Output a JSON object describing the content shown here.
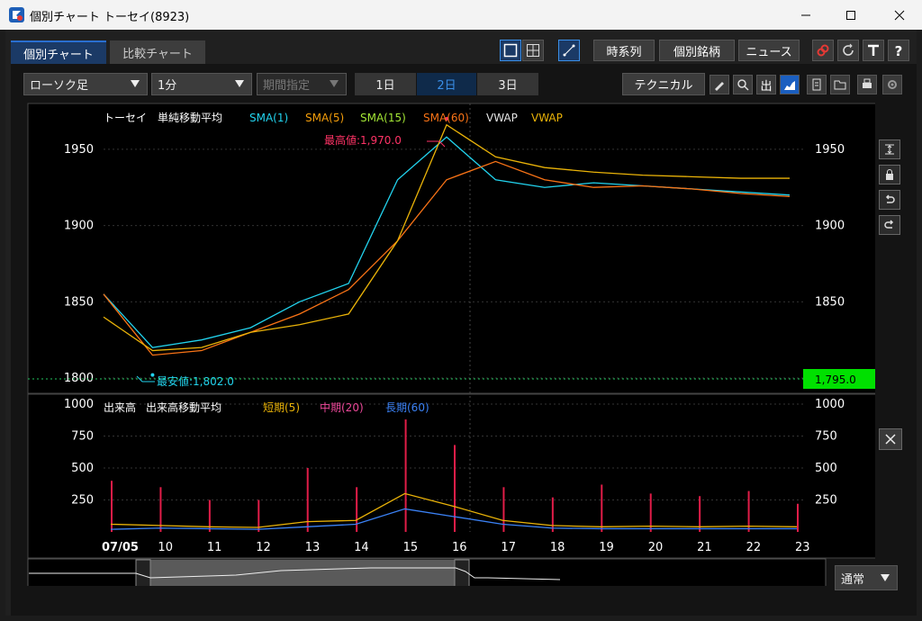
{
  "window": {
    "title": "個別チャート トーセイ(8923)"
  },
  "tabs": [
    {
      "label": "個別チャート"
    },
    {
      "label": "比較チャート"
    }
  ],
  "top_buttons": {
    "timeseries": "時系列",
    "stock": "個別銘柄",
    "news": "ニュース"
  },
  "toolbar": {
    "chart_type": "ローソク足",
    "interval": "1分",
    "period": "期間指定",
    "days": [
      "1日",
      "2日",
      "3日"
    ],
    "active_day_index": 1,
    "technical": "テクニカル",
    "out_label": "出"
  },
  "colors": {
    "sma1": "#22d3ee",
    "sma5": "#f59e0b",
    "sma15": "#a3e635",
    "sma60": "#f97316",
    "vwap1": "#e5e5e5",
    "vwap2": "#eab308",
    "vol_short": "#eab308",
    "vol_mid": "#ec4899",
    "vol_long": "#3b82f6",
    "price_tag": "#00e000",
    "high_label": "#ff3366",
    "low_label": "#22d3ee"
  },
  "price_panel": {
    "legend": {
      "name": "トーセイ",
      "indicator": "単純移動平均",
      "sma1": "SMA(1)",
      "sma5": "SMA(5)",
      "sma15": "SMA(15)",
      "sma60": "SMA(60)",
      "vwap1": "VWAP",
      "vwap2": "VWAP"
    },
    "high_label": "最高値:1,970.0",
    "low_label": "最安値:1,802.0",
    "current_price": "1,795.0",
    "y_ticks": [
      "1950",
      "1900",
      "1850",
      "1800"
    ]
  },
  "volume_panel": {
    "legend": {
      "name": "出来高",
      "indicator": "出来高移動平均",
      "short": "短期(5)",
      "mid": "中期(20)",
      "long": "長期(60)"
    },
    "y_ticks": [
      "1000",
      "750",
      "500",
      "250"
    ]
  },
  "x_axis": {
    "labels": [
      "07/05",
      "10",
      "11",
      "12",
      "13",
      "14",
      "15",
      "16",
      "17",
      "18",
      "19",
      "20",
      "21",
      "22",
      "23"
    ]
  },
  "navigator": {
    "mode": "通常"
  },
  "chart_data": [
    {
      "type": "line",
      "title": "",
      "ylim": [
        1790,
        1980
      ],
      "x": [
        "07/05",
        "10",
        "11",
        "12",
        "13",
        "14",
        "15",
        "16",
        "17",
        "18",
        "19",
        "20",
        "21",
        "22",
        "23"
      ],
      "series": [
        {
          "name": "SMA(1)",
          "values": [
            1855,
            1820,
            1825,
            1833,
            1850,
            1862,
            1930,
            1958,
            1930,
            1925,
            1928,
            1926,
            1924,
            1922,
            1920
          ]
        },
        {
          "name": "SMA(60)",
          "values": [
            1855,
            1815,
            1818,
            1830,
            1842,
            1858,
            1890,
            1930,
            1942,
            1930,
            1925,
            1926,
            1924,
            1921,
            1919
          ]
        },
        {
          "name": "VWAP",
          "values": [
            1840,
            1818,
            1820,
            1830,
            1835,
            1842,
            1890,
            1966,
            1945,
            1938,
            1935,
            1933,
            1932,
            1931,
            1931
          ]
        }
      ],
      "annotations": {
        "high": 1970.0,
        "low": 1802.0,
        "current": 1795.0
      }
    },
    {
      "type": "bar",
      "title": "",
      "ylim": [
        0,
        1000
      ],
      "categories": [
        "07/05",
        "10",
        "11",
        "12",
        "13",
        "14",
        "15",
        "16",
        "17",
        "18",
        "19",
        "20",
        "21",
        "22",
        "23"
      ],
      "series": [
        {
          "name": "短期(5)",
          "values": [
            60,
            50,
            40,
            35,
            80,
            90,
            300,
            200,
            90,
            50,
            40,
            45,
            40,
            45,
            40
          ]
        },
        {
          "name": "長期(60)",
          "values": [
            20,
            30,
            25,
            20,
            40,
            60,
            180,
            120,
            60,
            30,
            25,
            25,
            25,
            25,
            25
          ]
        }
      ],
      "peaks": [
        400,
        350,
        250,
        250,
        500,
        350,
        880,
        680,
        350,
        270,
        370,
        300,
        280,
        320,
        220
      ]
    }
  ]
}
